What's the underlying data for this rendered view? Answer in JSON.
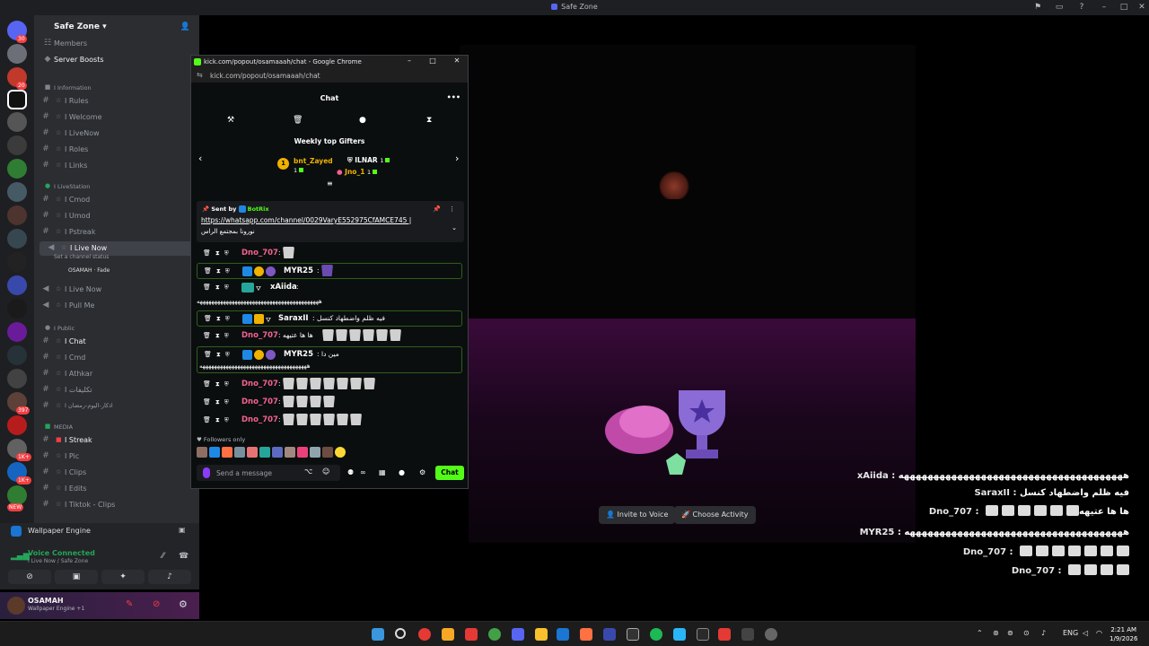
{
  "window": {
    "title": "Safe Zone"
  },
  "server": {
    "name": "Safe Zone"
  },
  "sidebar": {
    "members": "Members",
    "server_boosts": "Server Boosts",
    "cat_information": "I Information",
    "ch_rules": "I Rules",
    "ch_welcome": "I Welcome",
    "ch_livenow": "I LiveNow",
    "ch_roles": "I Roles",
    "ch_links": "I Links",
    "cat_livestation": "I LiveStation",
    "ch_cmod": "I Cmod",
    "ch_umod": "I Umod",
    "ch_pstreak": "I Pstreak",
    "ch_live_now_voice": "I Live Now",
    "set_status": "Set a channel status",
    "voice_user": "OSAMAH",
    "voice_user_activity": "Fade",
    "ch_live_now_2": "I Live Now",
    "ch_pull_me": "I Pull Me",
    "cat_public": "I Public",
    "ch_chat": "I Chat",
    "ch_cmd": "I Cmd",
    "ch_athkar": "I Athkar",
    "ch_takleefat": "I تكليفات",
    "ch_athkar2": "I اذكار-اليوم-رمضان",
    "cat_media": "MEDIA",
    "ch_streak": "I Streak",
    "ch_pic": "I Pic",
    "ch_clips": "I Clips",
    "ch_edits": "I Edits",
    "ch_tiktok": "I Tiktok - Clips"
  },
  "rail_badges": [
    "30",
    "20",
    "397",
    "1K+",
    "1K+",
    "NEW"
  ],
  "voice_panel": {
    "wallpaper": "Wallpaper Engine",
    "connected": "Voice Connected",
    "channel": "I Live Now / Safe Zone"
  },
  "user": {
    "name": "OSAMAH",
    "status": "Wallpaper Engine +1"
  },
  "stage": {
    "invite": "Invite to Voice",
    "activity": "Choose Activity"
  },
  "popup": {
    "title": "kick.com/popout/osamaaah/chat - Google Chrome",
    "url": "kick.com/popout/osamaaah/chat",
    "header": "Chat",
    "gifters_title": "Weekly top Gifters",
    "gifters": [
      {
        "rank": "1",
        "name": "bnt_Zayed",
        "count": "1",
        "color": "#f0b100"
      },
      {
        "rank": "",
        "name": "ILNAR",
        "count": "1",
        "color": "#ffffff"
      },
      {
        "rank": "",
        "name": "Jno_1",
        "count": "1",
        "color": "#f0b100"
      }
    ],
    "pinned": {
      "sent_by": "Sent by",
      "bot": "BotRix",
      "link": "https://whatsapp.com/channel/0029VaryE552975CfAMCE745 |",
      "arabic": "نورونا بمجتمع الراس"
    },
    "followers_only": "Followers only",
    "input_placeholder": "Send a message",
    "chat_button": "Chat"
  },
  "messages": [
    {
      "user": "Dno_707",
      "color": "#f2628f",
      "text": ""
    },
    {
      "user": "MYR25",
      "color": "#ffffff",
      "text": ""
    },
    {
      "user": "xAiida",
      "color": "#ffffff",
      "text": ""
    },
    {
      "wrap": "ههههههههههههههههههههههههههههههههههههههههههه"
    },
    {
      "user": "SaraxII",
      "color": "#ffffff",
      "text": "فيه ظلم واضطهاد كنسل"
    },
    {
      "user": "Dno_707",
      "color": "#f2628f",
      "text": "ها ها عتيهه"
    },
    {
      "user": "MYR25",
      "color": "#ffffff",
      "text": "مين دا"
    },
    {
      "wrap": "هههههههههههههههههههههههههههههههههههههه"
    },
    {
      "user": "Dno_707",
      "color": "#f2628f",
      "text": ""
    },
    {
      "user": "Dno_707",
      "color": "#f2628f",
      "text": ""
    },
    {
      "user": "Dno_707",
      "color": "#f2628f",
      "text": ""
    }
  ],
  "overlay": [
    {
      "user": "xAiida",
      "sep": " : ",
      "text": "ههههههههههههههههههههههههههههههههههههههه"
    },
    {
      "user": "SaraxII",
      "sep": " : ",
      "text": "فيه ظلم واضطهاد كنسل"
    },
    {
      "user": "Dno_707",
      "sep": " : ",
      "text": "ها ها عتيهه"
    },
    {
      "user": "MYR25",
      "sep": " : ",
      "text": "هههههههههههههههههههههههههههههههههههههه"
    },
    {
      "user": "Dno_707",
      "sep": " : ",
      "text": ""
    },
    {
      "user": "Dno_707",
      "sep": " : ",
      "text": ""
    }
  ],
  "taskbar": {
    "lang": "ENG",
    "time": "2:21 AM",
    "date": "1/9/2026"
  },
  "colors": {
    "kick_green": "#53fc18",
    "discord_bg": "#2b2d31",
    "rail_bg": "#1e1f22",
    "name_pink": "#f2628f"
  }
}
